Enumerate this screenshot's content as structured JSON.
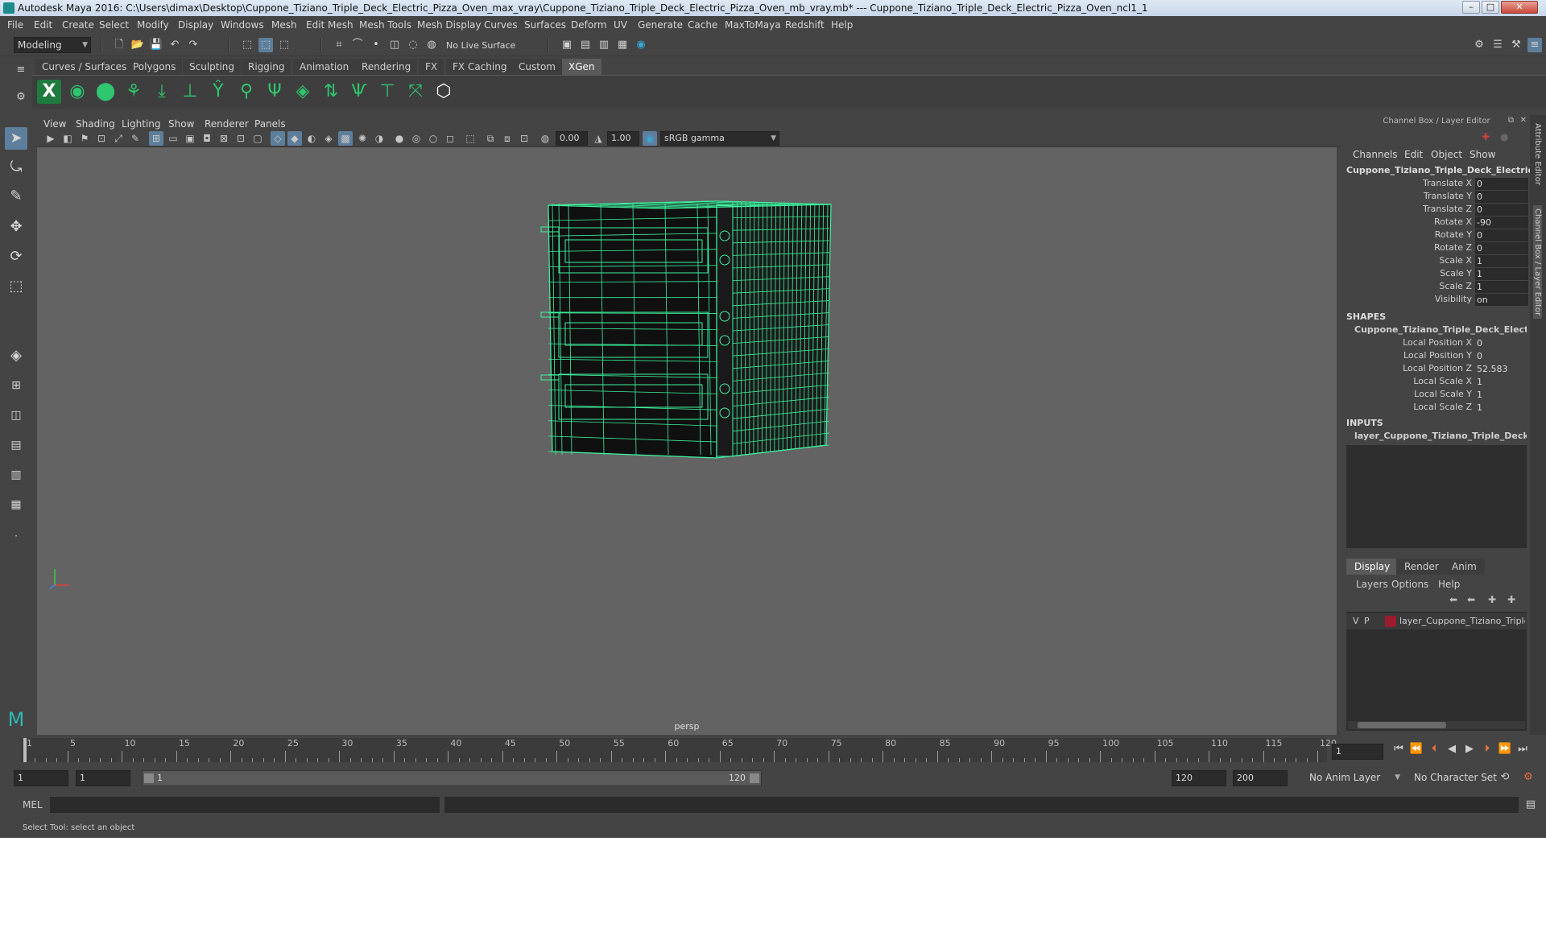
{
  "window": {
    "title": "Autodesk Maya 2016: C:\\Users\\dimax\\Desktop\\Cuppone_Tiziano_Triple_Deck_Electric_Pizza_Oven_max_vray\\Cuppone_Tiziano_Triple_Deck_Electric_Pizza_Oven_mb_vray.mb*   ---   Cuppone_Tiziano_Triple_Deck_Electric_Pizza_Oven_ncl1_1",
    "minimize": "–",
    "maximize": "□",
    "close": "✕"
  },
  "menubar": [
    "File",
    "Edit",
    "Create",
    "Select",
    "Modify",
    "Display",
    "Windows",
    "Mesh",
    "Edit Mesh",
    "Mesh Tools",
    "Mesh Display",
    "Curves",
    "Surfaces",
    "Deform",
    "UV",
    "Generate",
    "Cache",
    "MaxToMaya",
    "Redshift",
    "Help"
  ],
  "statusline": {
    "mode": "Modeling",
    "live_surface": "No Live Surface"
  },
  "shelf_tabs": [
    "Curves / Surfaces",
    "Polygons",
    "Sculpting",
    "Rigging",
    "Animation",
    "Rendering",
    "FX",
    "FX Caching",
    "Custom",
    "XGen"
  ],
  "shelf_active": "XGen",
  "viewport": {
    "menus": [
      "View",
      "Shading",
      "Lighting",
      "Show",
      "Renderer",
      "Panels"
    ],
    "exposure": "0.00",
    "gamma": "1.00",
    "color_space": "sRGB gamma",
    "camera_label": "persp",
    "wire_color": "#3ff2a0"
  },
  "channel_box": {
    "header": "Channel Box / Layer Editor",
    "menus": [
      "Channels",
      "Edit",
      "Object",
      "Show"
    ],
    "object_name": "Cuppone_Tiziano_Triple_Deck_Electric_Pi...",
    "attributes": [
      {
        "label": "Translate X",
        "value": "0"
      },
      {
        "label": "Translate Y",
        "value": "0"
      },
      {
        "label": "Translate Z",
        "value": "0"
      },
      {
        "label": "Rotate X",
        "value": "-90"
      },
      {
        "label": "Rotate Y",
        "value": "0"
      },
      {
        "label": "Rotate Z",
        "value": "0"
      },
      {
        "label": "Scale X",
        "value": "1"
      },
      {
        "label": "Scale Y",
        "value": "1"
      },
      {
        "label": "Scale Z",
        "value": "1"
      },
      {
        "label": "Visibility",
        "value": "on"
      }
    ],
    "shapes_label": "SHAPES",
    "shape_name": "Cuppone_Tiziano_Triple_Deck_Electric_...",
    "shape_attributes": [
      {
        "label": "Local Position X",
        "value": "0"
      },
      {
        "label": "Local Position Y",
        "value": "0"
      },
      {
        "label": "Local Position Z",
        "value": "52.583"
      },
      {
        "label": "Local Scale X",
        "value": "1"
      },
      {
        "label": "Local Scale Y",
        "value": "1"
      },
      {
        "label": "Local Scale Z",
        "value": "1"
      }
    ],
    "inputs_label": "INPUTS",
    "input_name": "layer_Cuppone_Tiziano_Triple_Deck_El..."
  },
  "layer_editor": {
    "tabs": [
      "Display",
      "Render",
      "Anim"
    ],
    "active_tab": "Display",
    "menus": [
      "Layers",
      "Options",
      "Help"
    ],
    "layer": {
      "v": "V",
      "p": "P",
      "name": "layer_Cuppone_Tiziano_Triple_",
      "color": "#9a1c2e"
    }
  },
  "side_strip": {
    "attribute_editor": "Attribute Editor",
    "channel_box": "Channel Box / Layer Editor"
  },
  "timeline": {
    "ticks": [
      "1",
      "5",
      "10",
      "15",
      "20",
      "25",
      "30",
      "35",
      "40",
      "45",
      "50",
      "55",
      "60",
      "65",
      "70",
      "75",
      "80",
      "85",
      "90",
      "95",
      "100",
      "105",
      "110",
      "115",
      "120"
    ],
    "current_frame": "1"
  },
  "range": {
    "start": "1",
    "playback_start": "1",
    "range_start": "1",
    "range_end": "120",
    "playback_end": "120",
    "end": "200",
    "anim_layer": "No Anim Layer",
    "char_set": "No Character Set"
  },
  "cmdline": {
    "lang": "MEL"
  },
  "helpline": {
    "text": "Select Tool: select an object"
  }
}
